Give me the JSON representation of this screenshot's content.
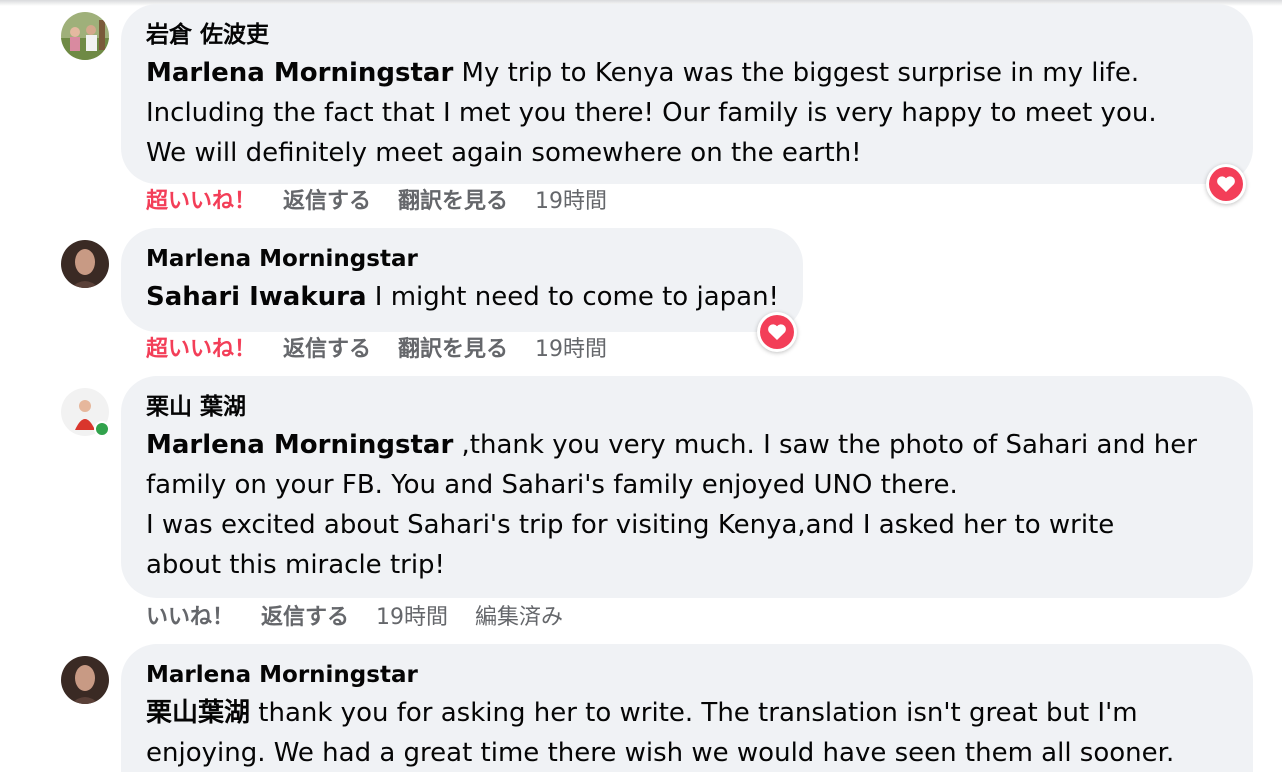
{
  "comments": [
    {
      "author": "岩倉 佐波吏",
      "mention": "Marlena Morningstar",
      "lines": [
        " My trip to Kenya was the biggest surprise in my life.",
        "Including the fact that I met you there! Our family is very happy to meet you.",
        "We will definitely meet again somewhere on the earth!"
      ],
      "actions": {
        "like": "超いいね！",
        "reply": "返信する",
        "translate": "翻訳を見る",
        "time": "19時間"
      },
      "reaction": "love"
    },
    {
      "author": "Marlena Morningstar",
      "mention": "Sahari Iwakura",
      "lines": [
        " I might need to come to japan!"
      ],
      "actions": {
        "like": "超いいね！",
        "reply": "返信する",
        "translate": "翻訳を見る",
        "time": "19時間"
      },
      "reaction": "love"
    },
    {
      "author": "栗山 葉湖",
      "mention": "Marlena Morningstar",
      "lines": [
        " ,thank you very much. I saw the photo of Sahari and her",
        "family on your FB. You and Sahari's family enjoyed UNO there.",
        "I was excited about Sahari's trip for visiting Kenya,and I asked her to write",
        "about this miracle trip!"
      ],
      "actions": {
        "like": "いいね！",
        "reply": "返信する",
        "time": "19時間",
        "edited": "編集済み"
      },
      "online": true
    },
    {
      "author": "Marlena Morningstar",
      "mention": "栗山葉湖",
      "lines": [
        " thank you for asking her to write. The translation isn't great but I'm",
        "enjoying. We had a great time there wish we would have seen them all sooner."
      ]
    }
  ],
  "colors": {
    "bubble": "#f0f2f5",
    "love": "#f33e58",
    "secondary_text": "#65676b",
    "online": "#31a24c"
  },
  "icons": {
    "reaction": "heart-icon"
  }
}
